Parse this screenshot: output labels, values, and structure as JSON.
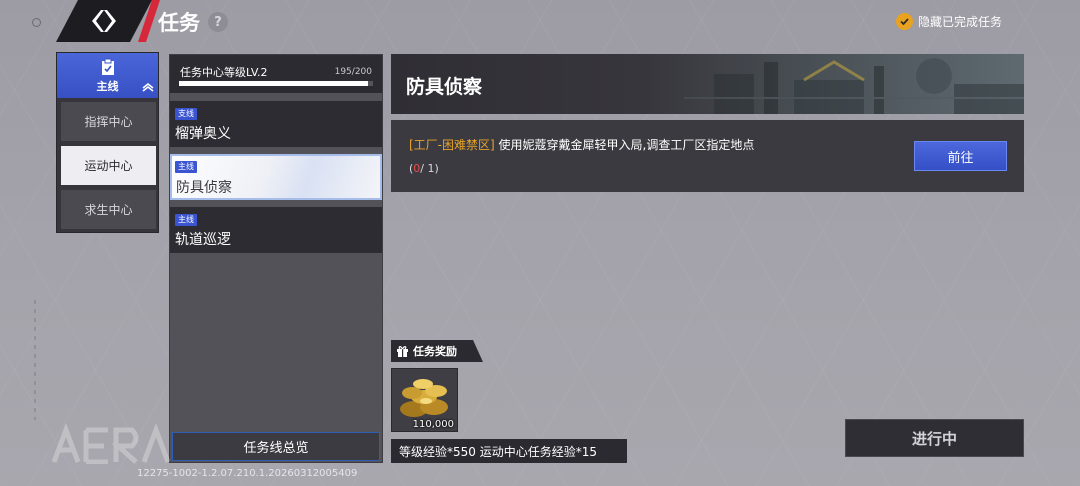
{
  "header": {
    "title": "任务",
    "help_icon": "?",
    "hide_completed_label": "隐藏已完成任务",
    "hide_completed_checked": true
  },
  "tabs": {
    "main": {
      "label": "主线",
      "icon": "clipboard-icon"
    },
    "items": [
      {
        "label": "指挥中心",
        "active": false
      },
      {
        "label": "运动中心",
        "active": true
      },
      {
        "label": "求生中心",
        "active": false
      }
    ]
  },
  "task_list": {
    "level_label": "任务中心等级LV.2",
    "progress_text": "195/200",
    "progress_fraction": 0.975,
    "quests": [
      {
        "badge": "支线",
        "name": "榴弹奥义",
        "selected": false
      },
      {
        "badge": "主线",
        "name": "防具侦察",
        "selected": true
      },
      {
        "badge": "主线",
        "name": "轨道巡逻",
        "selected": false
      }
    ],
    "overview_label": "任务线总览"
  },
  "detail": {
    "title": "防具侦察",
    "objective_location": "[工厂-困难禁区]",
    "objective_text": "使用妮蔻穿戴金犀轻甲入局,调查工厂区指定地点",
    "count_open": "(",
    "count_current": "0",
    "count_rest": "/ 1)",
    "goto_label": "前往"
  },
  "rewards": {
    "title": "任务奖励",
    "item_quantity": "110,000",
    "item_icon": "gold-coins-icon",
    "exp_text": "等级经验*550  运动中心任务经验*15"
  },
  "status_label": "进行中",
  "version": "12275-1002-1.2.07.210.1.20260312005409",
  "colors": {
    "accent_blue": "#3b55d2",
    "accent_red": "#d6283a",
    "highlight_orange": "#e7a32a",
    "count_red": "#e74d4d"
  }
}
